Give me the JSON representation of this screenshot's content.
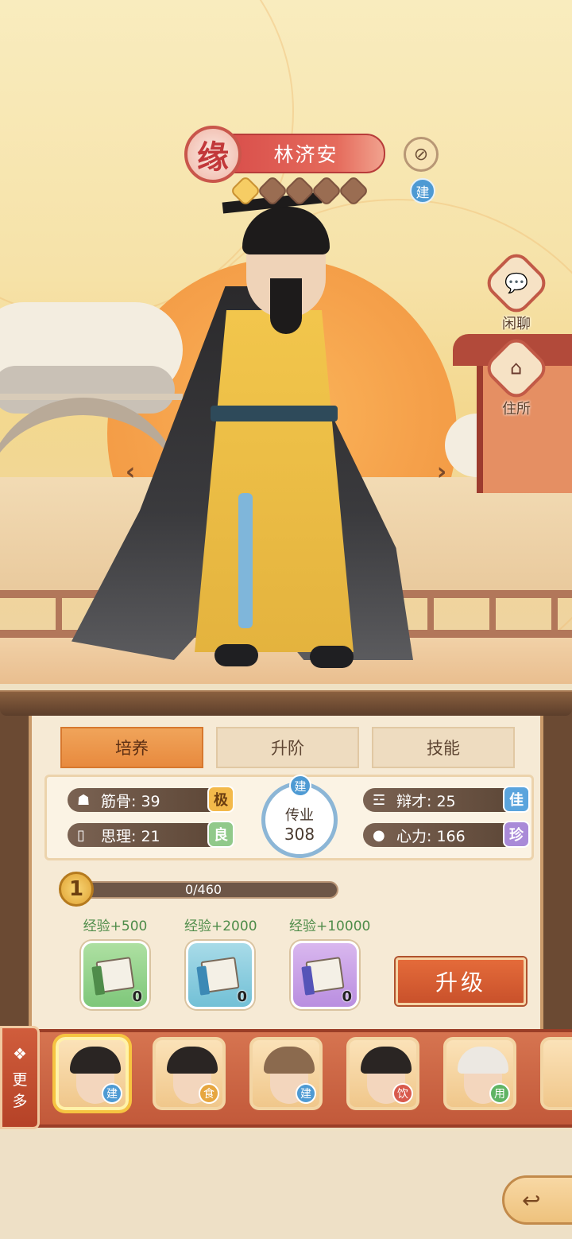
{
  "character": {
    "badge": "缘",
    "name": "林济安",
    "stars_total": 5,
    "stars_active": 1,
    "tag": "建"
  },
  "side_buttons": {
    "chat_label": "闲聊",
    "residence_label": "住所"
  },
  "nav": {
    "prev": "‹",
    "next": "›"
  },
  "tabs": [
    {
      "label": "培养",
      "active": true
    },
    {
      "label": "升阶",
      "active": false
    },
    {
      "label": "技能",
      "active": false
    }
  ],
  "stats": {
    "jingu": {
      "label": "筋骨: 39",
      "grade": "极"
    },
    "sili": {
      "label": "思理: 21",
      "grade": "良"
    },
    "biancai": {
      "label": "辩才: 25",
      "grade": "佳"
    },
    "xinli": {
      "label": "心力: 166",
      "grade": "珍"
    },
    "legacy": {
      "tag": "建",
      "label": "传业",
      "value": "308"
    }
  },
  "experience": {
    "level": "1",
    "text": "0/460",
    "progress": 0
  },
  "exp_items": [
    {
      "label": "经验+500",
      "count": "0",
      "color": "green"
    },
    {
      "label": "经验+2000",
      "count": "0",
      "color": "blue"
    },
    {
      "label": "经验+10000",
      "count": "0",
      "color": "purple"
    }
  ],
  "upgrade_label": "升级",
  "roster": {
    "more_label_1": "更",
    "more_label_2": "多",
    "members": [
      {
        "badge": "建",
        "selected": true
      },
      {
        "badge": "食",
        "selected": false
      },
      {
        "badge": "建",
        "selected": false
      },
      {
        "badge": "饮",
        "selected": false
      },
      {
        "badge": "用",
        "selected": false
      }
    ]
  },
  "icons": {
    "share": "share-icon",
    "chat": "chat-bubble-icon",
    "residence": "house-icon",
    "back": "back-arrow-icon",
    "more": "grid-icon"
  },
  "colors": {
    "tab_active": "#e88a3e",
    "upgrade": "#c9512b",
    "roster_bg": "#c2593a"
  }
}
